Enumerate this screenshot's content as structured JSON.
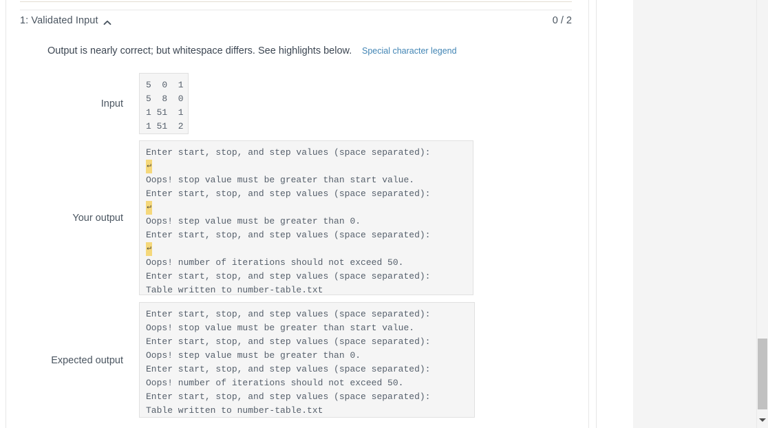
{
  "test_case": {
    "title": "1: Validated Input",
    "score": "0 / 2",
    "collapse_icon": "chevron-up-icon"
  },
  "feedback": {
    "message": "Output is nearly correct; but whitespace differs. See highlights below.",
    "legend_link": "Special character legend",
    "link_color": "#4285b4"
  },
  "labels": {
    "input": "Input",
    "your_output": "Your output",
    "expected_output": "Expected output"
  },
  "input_box": {
    "lines": [
      "5  0  1",
      "5  8  0",
      "1 51  1",
      "1 51  2"
    ]
  },
  "your_output": {
    "highlight_color": "#f5d87b",
    "highlight_glyph": "↵",
    "lines": [
      {
        "text": "Enter start, stop, and step values (space separated):",
        "highlight": false
      },
      {
        "text": "",
        "highlight": true
      },
      {
        "text": "Oops! stop value must be greater than start value.",
        "highlight": false
      },
      {
        "text": "Enter start, stop, and step values (space separated):",
        "highlight": false
      },
      {
        "text": "",
        "highlight": true
      },
      {
        "text": "Oops! step value must be greater than 0.",
        "highlight": false
      },
      {
        "text": "Enter start, stop, and step values (space separated):",
        "highlight": false
      },
      {
        "text": "",
        "highlight": true
      },
      {
        "text": "Oops! number of iterations should not exceed 50.",
        "highlight": false
      },
      {
        "text": "Enter start, stop, and step values (space separated):",
        "highlight": false
      },
      {
        "text": "Table written to number-table.txt",
        "highlight": false
      }
    ]
  },
  "expected_output": {
    "lines": [
      "Enter start, stop, and step values (space separated):",
      "Oops! stop value must be greater than start value.",
      "Enter start, stop, and step values (space separated):",
      "Oops! step value must be greater than 0.",
      "Enter start, stop, and step values (space separated):",
      "Oops! number of iterations should not exceed 50.",
      "Enter start, stop, and step values (space separated):",
      "Table written to number-table.txt"
    ]
  },
  "scrollbar": {
    "arrow_icon": "chevron-down-icon"
  }
}
